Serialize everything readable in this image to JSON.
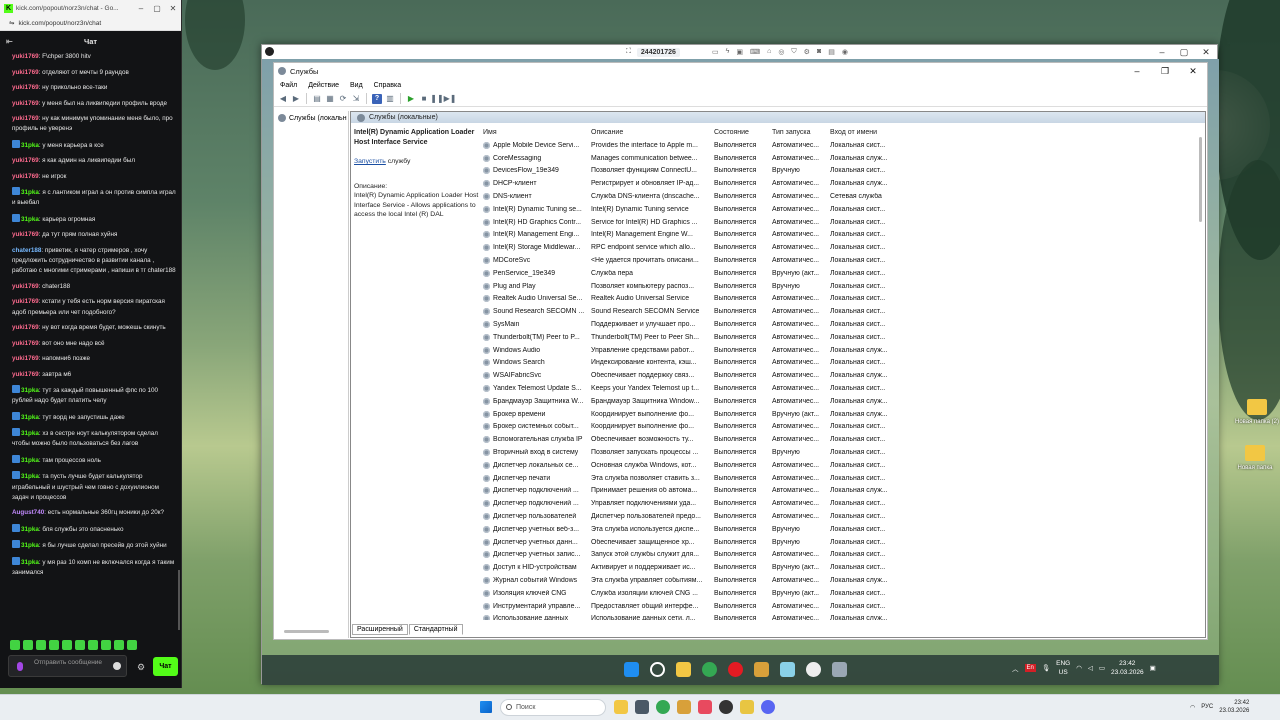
{
  "chat_window": {
    "url": "kick.com/popout/norz3n/chat",
    "tab_title": "kick.com/popout/norz3n/chat - Go...",
    "header_title": "Чат",
    "messages": [
      {
        "user": "yuki1769",
        "text": ": F\\chper 3800 hitv",
        "badge": false,
        "cls": "u-y"
      },
      {
        "user": "yuki1769",
        "text": ": отделяют от мечты 9 раундов",
        "badge": false,
        "cls": "u-y"
      },
      {
        "user": "yuki1769",
        "text": ": ну прикольно все-таки",
        "badge": false,
        "cls": "u-y"
      },
      {
        "user": "yuki1769",
        "text": ": у меня был на ликвипедии профиль вроде",
        "badge": false,
        "cls": "u-y"
      },
      {
        "user": "yuki1769",
        "text": ": ну как минимум упоминание меня было, про профиль не уверенэ",
        "badge": false,
        "cls": "u-y"
      },
      {
        "user": "31pka",
        "text": ": у меня карьера в ксе",
        "badge": true,
        "cls": "u-s"
      },
      {
        "user": "yuki1769",
        "text": ": я как админ на ликвипедии был",
        "badge": false,
        "cls": "u-y"
      },
      {
        "user": "yuki1769",
        "text": ": не игрок",
        "badge": false,
        "cls": "u-y"
      },
      {
        "user": "31pka",
        "text": ": я с лантиком играл а он против симпла играл и выебал",
        "badge": true,
        "cls": "u-s"
      },
      {
        "user": "31pka",
        "text": ": карьера огромная",
        "badge": true,
        "cls": "u-s"
      },
      {
        "user": "yuki1769",
        "text": ": да тут прям полная хуйня",
        "badge": false,
        "cls": "u-y"
      },
      {
        "user": "chater188",
        "text": ": приветик, я чатер стримеров , хочу предложить сотрудничество в развитии канала , работаю с многими стримерами , напиши в тг chater188",
        "badge": false,
        "cls": "u-c"
      },
      {
        "user": "yuki1769",
        "text": ": chater188",
        "badge": false,
        "cls": "u-y"
      },
      {
        "user": "yuki1769",
        "text": ": кстати у тебя есть норм версия пиратская адоб премьера или чет подобного?",
        "badge": false,
        "cls": "u-y"
      },
      {
        "user": "yuki1769",
        "text": ": ну вот когда время будет, можешь скинуть",
        "badge": false,
        "cls": "u-y"
      },
      {
        "user": "yuki1769",
        "text": ": вот оно мне надо всё",
        "badge": false,
        "cls": "u-y"
      },
      {
        "user": "yuki1769",
        "text": ": напомни6 позже",
        "badge": false,
        "cls": "u-y"
      },
      {
        "user": "yuki1769",
        "text": ": завтра м6",
        "badge": false,
        "cls": "u-y"
      },
      {
        "user": "31pka",
        "text": ": тут за каждый повышенный фпс по 100 рублей надо будет платить челу",
        "badge": true,
        "cls": "u-s"
      },
      {
        "user": "31pka",
        "text": ": тут ворд не запустишь даже",
        "badge": true,
        "cls": "u-s"
      },
      {
        "user": "31pka",
        "text": ": хз в сестре ноут калькулятором сделал чтобы можно было пользоваться без лагов",
        "badge": true,
        "cls": "u-s"
      },
      {
        "user": "31pka",
        "text": ": там процессов ноль",
        "badge": true,
        "cls": "u-s"
      },
      {
        "user": "31pka",
        "text": ": та пусть лучше будет калькулятор играбельный и шустрый чем говно с дохуилионом задач и процессов",
        "badge": true,
        "cls": "u-s"
      },
      {
        "user": "August740",
        "text": ": есть нормальные 360гц моники до 20к?",
        "badge": false,
        "cls": "u-a"
      },
      {
        "user": "31pka",
        "text": ": бля службы это опасненько",
        "badge": true,
        "cls": "u-s"
      },
      {
        "user": "31pka",
        "text": ": я бы лучше сделал пресейв до этой хуйни",
        "badge": true,
        "cls": "u-s"
      },
      {
        "user": "31pka",
        "text": ": у мя раз 10 комп не включался когда я таким занимался",
        "badge": true,
        "cls": "u-s"
      }
    ],
    "input_placeholder": "Отправить сообщение",
    "send_label": "Чат"
  },
  "viewer": {
    "session_id": "244201726"
  },
  "services": {
    "window_title": "Службы",
    "menu": [
      "Файл",
      "Действие",
      "Вид",
      "Справка"
    ],
    "tree_label": "Службы (локальн",
    "pane_title": "Службы (локальные)",
    "selected_name": "Intel(R) Dynamic Application Loader Host Interface Service",
    "start_link": "Запустить",
    "start_suffix": " службу",
    "description_label": "Описание:",
    "description_text": "Intel(R) Dynamic Application Loader Host Interface Service - Allows applications to access the local Intel (R) DAL",
    "columns": [
      "Имя",
      "Описание",
      "Состояние",
      "Тип запуска",
      "Вход от имени"
    ],
    "rows": [
      [
        "Apple Mobile Device Servi...",
        "Provides the interface to Apple m...",
        "Выполняется",
        "Автоматичес...",
        "Локальная сист..."
      ],
      [
        "CoreMessaging",
        "Manages communication betwee...",
        "Выполняется",
        "Автоматичес...",
        "Локальная служ..."
      ],
      [
        "DevicesFlow_19e349",
        "Позволяет функциям ConnectU...",
        "Выполняется",
        "Вручную",
        "Локальная сист..."
      ],
      [
        "DHCP-клиент",
        "Регистрирует и обновляет IP-ад...",
        "Выполняется",
        "Автоматичес...",
        "Локальная служ..."
      ],
      [
        "DNS-клиент",
        "Служба DNS-клиента (dnscache...",
        "Выполняется",
        "Автоматичес...",
        "Сетевая служба"
      ],
      [
        "Intel(R) Dynamic Tuning se...",
        "Intel(R) Dynamic Tuning service",
        "Выполняется",
        "Автоматичес...",
        "Локальная сист..."
      ],
      [
        "Intel(R) HD Graphics Contr...",
        "Service for Intel(R) HD Graphics ...",
        "Выполняется",
        "Автоматичес...",
        "Локальная сист..."
      ],
      [
        "Intel(R) Management Engi...",
        "Intel(R) Management Engine W...",
        "Выполняется",
        "Автоматичес...",
        "Локальная сист..."
      ],
      [
        "Intel(R) Storage Middlewar...",
        "RPC endpoint service which allo...",
        "Выполняется",
        "Автоматичес...",
        "Локальная сист..."
      ],
      [
        "MDCoreSvc",
        "<Не удается прочитать описани...",
        "Выполняется",
        "Автоматичес...",
        "Локальная сист..."
      ],
      [
        "PenService_19e349",
        "Служба пера",
        "Выполняется",
        "Вручную (акт...",
        "Локальная сист..."
      ],
      [
        "Plug and Play",
        "Позволяет компьютеру распоз...",
        "Выполняется",
        "Вручную",
        "Локальная сист..."
      ],
      [
        "Realtek Audio Universal Se...",
        "Realtek Audio Universal Service",
        "Выполняется",
        "Автоматичес...",
        "Локальная сист..."
      ],
      [
        "Sound Research SECOMN ...",
        "Sound Research SECOMN Service",
        "Выполняется",
        "Автоматичес...",
        "Локальная сист..."
      ],
      [
        "SysMain",
        "Поддерживает и улучшает про...",
        "Выполняется",
        "Автоматичес...",
        "Локальная сист..."
      ],
      [
        "Thunderbolt(TM) Peer to P...",
        "Thunderbolt(TM) Peer to Peer Sh...",
        "Выполняется",
        "Автоматичес...",
        "Локальная сист..."
      ],
      [
        "Windows Audio",
        "Управление средствами работ...",
        "Выполняется",
        "Автоматичес...",
        "Локальная служ..."
      ],
      [
        "Windows Search",
        "Индексирование контента, кэш...",
        "Выполняется",
        "Автоматичес...",
        "Локальная сист..."
      ],
      [
        "WSAIFabricSvc",
        "Обеспечивает поддержку связ...",
        "Выполняется",
        "Автоматичес...",
        "Локальная служ..."
      ],
      [
        "Yandex Telemost Update S...",
        "Keeps your Yandex Telemost up t...",
        "Выполняется",
        "Автоматичес...",
        "Локальная сист..."
      ],
      [
        "Брандмауэр Защитника W...",
        "Брандмауэр Защитника Window...",
        "Выполняется",
        "Автоматичес...",
        "Локальная служ..."
      ],
      [
        "Брокер времени",
        "Координирует выполнение фо...",
        "Выполняется",
        "Вручную (акт...",
        "Локальная служ..."
      ],
      [
        "Брокер системных событ...",
        "Координирует выполнение фо...",
        "Выполняется",
        "Автоматичес...",
        "Локальная сист..."
      ],
      [
        "Вспомогательная служба IP",
        "Обеспечивает возможность ту...",
        "Выполняется",
        "Автоматичес...",
        "Локальная сист..."
      ],
      [
        "Вторичный вход в систему",
        "Позволяет запускать процессы ...",
        "Выполняется",
        "Вручную",
        "Локальная сист..."
      ],
      [
        "Диспетчер локальных се...",
        "Основная служба Windows, кот...",
        "Выполняется",
        "Автоматичес...",
        "Локальная сист..."
      ],
      [
        "Диспетчер печати",
        "Эта служба позволяет ставить з...",
        "Выполняется",
        "Автоматичес...",
        "Локальная сист..."
      ],
      [
        "Диспетчер подключений ...",
        "Принимает решения об автома...",
        "Выполняется",
        "Автоматичес...",
        "Локальная служ..."
      ],
      [
        "Диспетчер подключений ...",
        "Управляет подключениями уда...",
        "Выполняется",
        "Автоматичес...",
        "Локальная сист..."
      ],
      [
        "Диспетчер пользователей",
        "Диспетчер пользователей предо...",
        "Выполняется",
        "Автоматичес...",
        "Локальная сист..."
      ],
      [
        "Диспетчер учетных веб-з...",
        "Эта служба используется диспе...",
        "Выполняется",
        "Вручную",
        "Локальная сист..."
      ],
      [
        "Диспетчер учетных данн...",
        "Обеспечивает защищенное хр...",
        "Выполняется",
        "Вручную",
        "Локальная сист..."
      ],
      [
        "Диспетчер учетных запис...",
        "Запуск этой службы служит для...",
        "Выполняется",
        "Автоматичес...",
        "Локальная сист..."
      ],
      [
        "Доступ к HID-устройствам",
        "Активирует и поддерживает ис...",
        "Выполняется",
        "Вручную (акт...",
        "Локальная сист..."
      ],
      [
        "Журнал событий Windows",
        "Эта служба управляет событиям...",
        "Выполняется",
        "Автоматичес...",
        "Локальная служ..."
      ],
      [
        "Изоляция ключей CNG",
        "Служба изоляции ключей CNG ...",
        "Выполняется",
        "Вручную (акт...",
        "Локальная сист..."
      ],
      [
        "Инструментарий управле...",
        "Предоставляет общий интерфе...",
        "Выполняется",
        "Автоматичес...",
        "Локальная сист..."
      ],
      [
        "Использование данных",
        "Использование данных сети, л...",
        "Выполняется",
        "Автоматичес...",
        "Локальная служ..."
      ]
    ],
    "tabs": [
      "Расширенный",
      "Стандартный"
    ]
  },
  "remote_desktop": {
    "icons": [
      "Новая папка (2)",
      "Новая папка"
    ],
    "tray_lang_1": "ENG",
    "tray_lang_2": "US",
    "clock_time": "23:42",
    "clock_date": "23.03.2026"
  },
  "host_taskbar": {
    "search_placeholder": "Поиск",
    "lang": "РУС",
    "clock_time": "23:42",
    "clock_date": "23.03.2026"
  }
}
